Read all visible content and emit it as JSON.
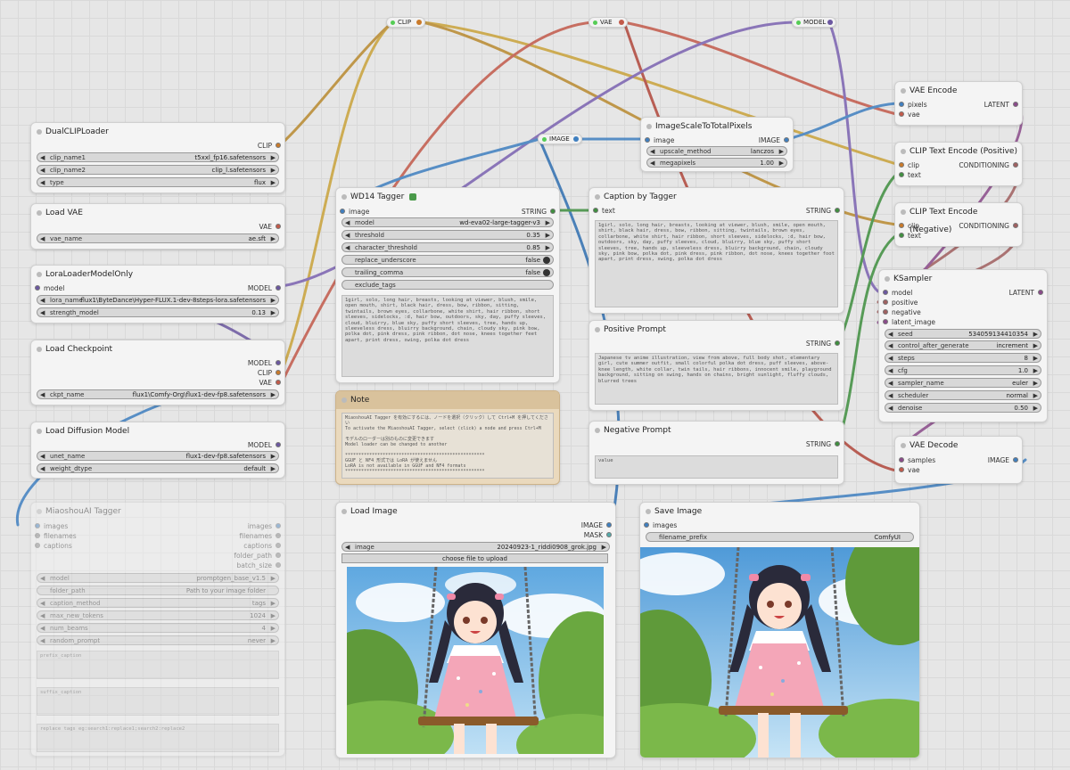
{
  "colors": {
    "clip": "#ffd500",
    "vae": "#ff6e6e",
    "model": "#b39ddb",
    "image": "#64b5f6",
    "latent": "#ff9cf9",
    "conditioning": "#ffa931",
    "string": "#9ccc65"
  },
  "reroutes": {
    "clip": "CLIP",
    "vae": "VAE",
    "model": "MODEL",
    "image": "IMAGE"
  },
  "dual_clip": {
    "title": "DualCLIPLoader",
    "out": "CLIP",
    "w": [
      {
        "l": "clip_name1",
        "v": "t5xxl_fp16.safetensors"
      },
      {
        "l": "clip_name2",
        "v": "clip_l.safetensors"
      },
      {
        "l": "type",
        "v": "flux"
      }
    ]
  },
  "load_vae": {
    "title": "Load VAE",
    "out": "VAE",
    "w": [
      {
        "l": "vae_name",
        "v": "ae.sft"
      }
    ]
  },
  "lora": {
    "title": "LoraLoaderModelOnly",
    "in": "model",
    "out": "MODEL",
    "w": [
      {
        "l": "lora_name",
        "v": "flux1\\ByteDance\\Hyper-FLUX.1-dev-8steps-lora.safetensors"
      },
      {
        "l": "strength_model",
        "v": "0.13"
      }
    ]
  },
  "checkpoint": {
    "title": "Load Checkpoint",
    "outs": [
      "MODEL",
      "CLIP",
      "VAE"
    ],
    "w": [
      {
        "l": "ckpt_name",
        "v": "flux1\\Comfy-Org\\flux1-dev-fp8.safetensors"
      }
    ]
  },
  "diffusion": {
    "title": "Load Diffusion Model",
    "out": "MODEL",
    "w": [
      {
        "l": "unet_name",
        "v": "flux1-dev-fp8.safetensors"
      },
      {
        "l": "weight_dtype",
        "v": "default"
      }
    ]
  },
  "miaoshou": {
    "title": "MiaoshouAI Tagger",
    "ins": [
      "images",
      "filenames",
      "captions"
    ],
    "outs": [
      "images",
      "filenames",
      "captions",
      "folder_path",
      "batch_size"
    ],
    "w": [
      {
        "l": "model",
        "v": "promptgen_base_v1.5"
      },
      {
        "l": "folder_path",
        "v": "Path to your image folder"
      },
      {
        "l": "caption_method",
        "v": "tags"
      },
      {
        "l": "max_new_tokens",
        "v": "1024"
      },
      {
        "l": "num_beams",
        "v": "4"
      },
      {
        "l": "random_prompt",
        "v": "never"
      }
    ],
    "prefix": "prefix_caption",
    "suffix": "suffix_caption",
    "replace": "replace tags eg:search1:replace1;search2:replace2"
  },
  "wd14": {
    "title": "WD14 Tagger",
    "in": "image",
    "out": "STRING",
    "w": [
      {
        "l": "model",
        "v": "wd-eva02-large-tagger-v3"
      },
      {
        "l": "threshold",
        "v": "0.35"
      },
      {
        "l": "character_threshold",
        "v": "0.85"
      }
    ],
    "toggles": [
      {
        "l": "replace_underscore",
        "v": "false"
      },
      {
        "l": "trailing_comma",
        "v": "false"
      }
    ],
    "exclude": "exclude_tags",
    "text": "1girl, solo, long hair, breasts, looking at viewer, blush, smile, open mouth, shirt, black hair, dress, bow, ribbon, sitting, twintails, brown eyes, collarbone, white shirt, hair ribbon, short sleeves, sidelocks, :d, hair bow, outdoors, sky, day, puffy sleeves, cloud, bluirry, blue sky, puffy short sleeves, tree, hands up, sleeveless dress, bluirry background, chain, cloudy sky, pink bow, polka dot, pink dress, pink ribbon, dot nose, knees together feet apart, print dress, swing, polka dot dress"
  },
  "note": {
    "title": "Note",
    "text": "MiaoshouAI Tagger を有効にするには、ノードを選択（クリック）して Ctrl+M を押してください\nTo activate the MiaoshouAI Tagger, select (click) a node and press Ctrl+M\n\nモデルのローダーは別のものに変更できます\nModel loader can be changed to another\n\n****************************************************\nGGUF と NF4 形式では LoRA が使えません\nLoRA is not available in GGUF and NF4 formats\n****************************************************"
  },
  "scale": {
    "title": "ImageScaleToTotalPixels",
    "in": "image",
    "out": "IMAGE",
    "w": [
      {
        "l": "upscale_method",
        "v": "lanczos"
      },
      {
        "l": "megapixels",
        "v": "1.00"
      }
    ]
  },
  "caption": {
    "title": "Caption by Tagger",
    "in": "text",
    "out": "STRING",
    "text": "1girl, solo, long hair, breasts, looking at viewer, blush, smile, open mouth, shirt, black hair, dress, bow, ribbon, sitting, twintails, brown eyes, collarbone, white shirt, hair ribbon, short sleeves, sidelocks, :d, hair bow, outdoors, sky, day, puffy sleeves, cloud, bluirry, blue sky, puffy short sleeves, tree, hands up, sleeveless dress, bluirry background, chain, cloudy sky, pink bow, polka dot, pink dress, pink ribbon, dot nose, knees together foot apart, print dress, swing, polka dot dress"
  },
  "positive": {
    "title": "Positive Prompt",
    "out": "STRING",
    "text": "Japanese tv anime illustration, view from above, full body shot, elementary girl, cute summer outfit, small colorful polka dot dress, puff sleeves, above-knee length, white collar, twin tails, hair ribbons, innocent smile, playground background, sitting on swing, hands on chains, bright sunlight, fluffy clouds, blurred trees"
  },
  "negative": {
    "title": "Negative Prompt",
    "out": "STRING",
    "text": "value"
  },
  "vae_encode": {
    "title": "VAE Encode",
    "ins": [
      "pixels",
      "vae"
    ],
    "out": "LATENT"
  },
  "clip_pos": {
    "title": "CLIP Text Encode (Positive)",
    "ins": [
      "clip",
      "text"
    ],
    "out": "CONDITIONING"
  },
  "clip_neg": {
    "title": "CLIP Text Encode (Negative)",
    "ins": [
      "clip",
      "text"
    ],
    "out": "CONDITIONING"
  },
  "ksampler": {
    "title": "KSampler",
    "ins": [
      "model",
      "positive",
      "negative",
      "latent_image"
    ],
    "out": "LATENT",
    "w": [
      {
        "l": "seed",
        "v": "534059134410354"
      },
      {
        "l": "control_after_generate",
        "v": "increment"
      },
      {
        "l": "steps",
        "v": "8"
      },
      {
        "l": "cfg",
        "v": "1.0"
      },
      {
        "l": "sampler_name",
        "v": "euler"
      },
      {
        "l": "scheduler",
        "v": "normal"
      },
      {
        "l": "denoise",
        "v": "0.50"
      }
    ]
  },
  "vae_decode": {
    "title": "VAE Decode",
    "ins": [
      "samples",
      "vae"
    ],
    "out": "IMAGE"
  },
  "load_image": {
    "title": "Load Image",
    "outs": [
      "IMAGE",
      "MASK"
    ],
    "w": [
      {
        "l": "image",
        "v": "20240923-1_riddi0908_grok.jpg"
      }
    ],
    "upload": "choose file to upload"
  },
  "save_image": {
    "title": "Save Image",
    "in": "images",
    "w": [
      {
        "l": "filename_prefix",
        "v": "ComfyUI"
      }
    ]
  }
}
